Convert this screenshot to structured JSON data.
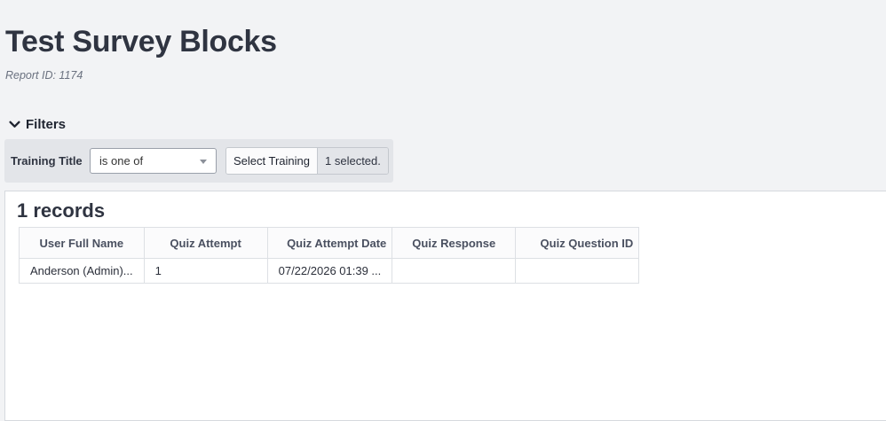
{
  "page": {
    "title": "Test Survey Blocks",
    "report_id": "Report ID: 1174"
  },
  "filters": {
    "toggle_label": "Filters",
    "training_title": {
      "label": "Training Title",
      "operator": "is one of",
      "select_button": "Select Training",
      "selected_text": "1 selected."
    }
  },
  "results": {
    "count_label": "1 records",
    "columns": [
      "User Full Name",
      "Quiz Attempt",
      "Quiz Attempt Date",
      "Quiz Response",
      "Quiz Question ID"
    ],
    "rows": [
      [
        "Anderson (Admin)...",
        "1",
        "07/22/2026 01:39 ...",
        "",
        ""
      ]
    ]
  },
  "icons": {
    "filters_toggle": "chevron-down-icon",
    "operator_dropdown": "caret-down-icon"
  },
  "colors": {
    "page_bg": "#f2f3f5",
    "panel_bg": "#e3e5e9",
    "title_text": "#2f3441"
  }
}
